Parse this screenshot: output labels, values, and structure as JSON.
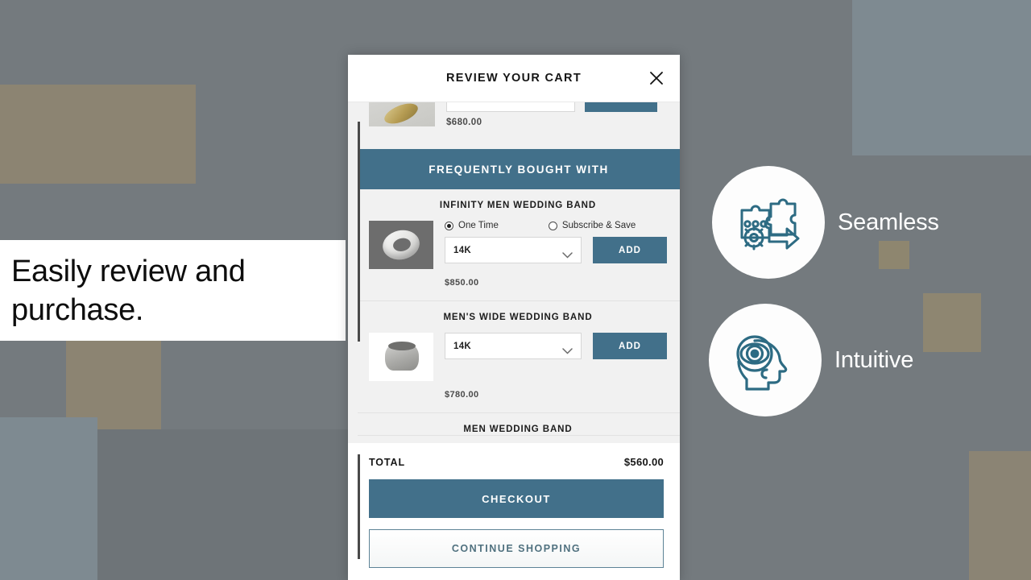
{
  "caption": {
    "text": "Easily review and purchase."
  },
  "features": [
    {
      "label": "Seamless",
      "icon": "puzzle-gear-arrow-icon"
    },
    {
      "label": "Intuitive",
      "icon": "head-eye-target-icon"
    }
  ],
  "cart": {
    "title": "REVIEW YOUR CART",
    "close_icon": "close-icon",
    "partial_item": {
      "price": "$680.00"
    },
    "frequently_bought_with": "FREQUENTLY BOUGHT WITH",
    "recommendations": [
      {
        "name": "INFINITY MEN WEDDING BAND",
        "one_time_label": "One Time",
        "subscribe_label": "Subscribe & Save",
        "selected_option": "One Time",
        "metal": "14K",
        "add_label": "ADD",
        "price": "$850.00"
      },
      {
        "name": "MEN'S WIDE WEDDING BAND",
        "metal": "14K",
        "add_label": "ADD",
        "price": "$780.00"
      },
      {
        "name": "MEN WEDDING BAND"
      }
    ],
    "footer": {
      "total_label": "TOTAL",
      "total_value": "$560.00",
      "checkout_label": "CHECKOUT",
      "continue_label": "CONTINUE SHOPPING"
    }
  },
  "colors": {
    "accent_blue": "#42708a",
    "background_gray": "#747a7e",
    "tan": "#8c8472",
    "light_blue_gray": "#7e8a91"
  }
}
